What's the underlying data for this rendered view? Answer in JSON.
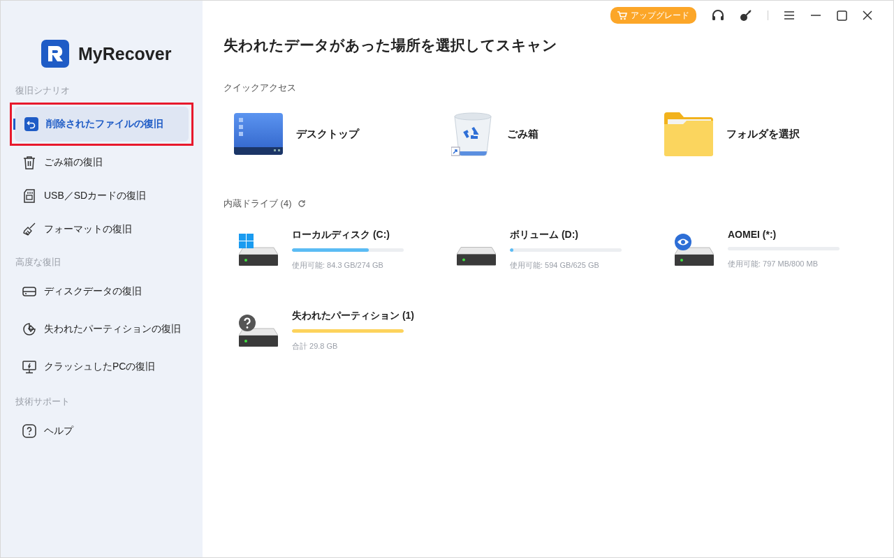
{
  "app": {
    "name": "MyRecover"
  },
  "titlebar": {
    "upgrade": "アップグレード"
  },
  "sidebar": {
    "sections": [
      {
        "label": "復旧シナリオ",
        "items": [
          {
            "label": "削除されたファイルの復旧",
            "selected": true,
            "highlighted": true
          },
          {
            "label": "ごみ箱の復旧",
            "selected": false,
            "highlighted": false
          },
          {
            "label": "USB／SDカードの復旧",
            "selected": false,
            "highlighted": false
          },
          {
            "label": "フォーマットの復旧",
            "selected": false,
            "highlighted": false
          }
        ]
      },
      {
        "label": "高度な復旧",
        "items": [
          {
            "label": "ディスクデータの復旧",
            "selected": false,
            "highlighted": false
          },
          {
            "label": "失われたパーティションの復旧",
            "selected": false,
            "highlighted": false
          },
          {
            "label": "クラッシュしたPCの復旧",
            "selected": false,
            "highlighted": false
          }
        ]
      },
      {
        "label": "技術サポート",
        "items": [
          {
            "label": "ヘルプ",
            "selected": false,
            "highlighted": false
          }
        ]
      }
    ]
  },
  "main": {
    "heading": "失われたデータがあった場所を選択してスキャン",
    "quick_access": {
      "label": "クイックアクセス",
      "items": [
        {
          "label": "デスクトップ"
        },
        {
          "label": "ごみ箱"
        },
        {
          "label": "フォルダを選択"
        }
      ]
    },
    "drives": {
      "label": "内蔵ドライブ (4)",
      "items": [
        {
          "name": "ローカルディスク (C:)",
          "kind": "system",
          "level": 0.69,
          "color": "#5bbcf4",
          "info": "使用可能: 84.3 GB/274 GB"
        },
        {
          "name": "ボリューム (D:)",
          "kind": "plain",
          "level": 0.03,
          "color": "#5bbcf4",
          "info": "使用可能: 594 GB/625 GB"
        },
        {
          "name": "AOMEI (*:)",
          "kind": "app",
          "info": "使用可能: 797 MB/800 MB"
        },
        {
          "name": "失われたパーティション (1)",
          "kind": "lost",
          "level": 1,
          "color": "#fdd35c",
          "info": "合計 29.8 GB"
        }
      ]
    }
  }
}
